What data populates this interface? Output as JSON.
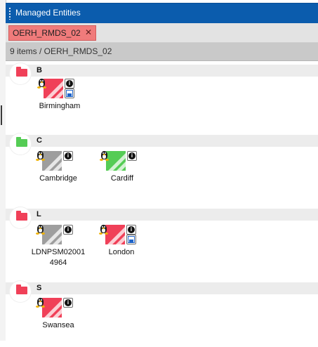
{
  "panel": {
    "title": "Managed Entities"
  },
  "tab": {
    "label": "OERH_RMDS_02",
    "close": "✕"
  },
  "status": {
    "text": "9 items  / OERH_RMDS_02"
  },
  "colors": {
    "red": "#f04058",
    "green": "#55cc55",
    "gray": "#9e9e9e"
  },
  "groups": [
    {
      "letter": "B",
      "folder": "red",
      "entities": [
        {
          "name": "Birmingham",
          "status": "red",
          "icons": [
            "linux-icon",
            "info-icon",
            "save-icon"
          ]
        }
      ]
    },
    {
      "letter": "C",
      "folder": "green",
      "entities": [
        {
          "name": "Cambridge",
          "status": "gray",
          "icons": [
            "linux-icon",
            "info-icon"
          ]
        },
        {
          "name": "Cardiff",
          "status": "green",
          "icons": [
            "linux-icon",
            "info-icon"
          ]
        }
      ]
    },
    {
      "letter": "L",
      "folder": "red",
      "entities": [
        {
          "name": "LDNPSM02001 4964",
          "status": "gray",
          "icons": [
            "linux-icon",
            "info-icon"
          ]
        },
        {
          "name": "London",
          "status": "red",
          "icons": [
            "linux-icon",
            "info-icon",
            "save-icon"
          ]
        }
      ]
    },
    {
      "letter": "S",
      "folder": "red",
      "entities": [
        {
          "name": "Swansea",
          "status": "red",
          "icons": [
            "linux-icon",
            "info-icon"
          ]
        }
      ]
    }
  ]
}
